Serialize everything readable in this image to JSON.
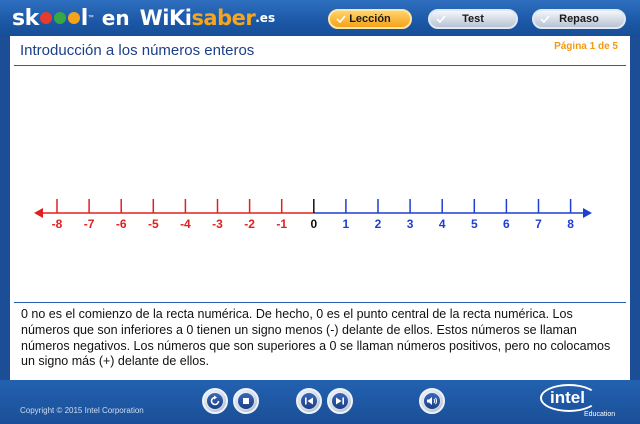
{
  "header": {
    "logo": {
      "skoool": "sk",
      "skoool_tail": "l",
      "tm": "™",
      "en": "en",
      "wikisaber": "WiKi",
      "saber": "saber",
      "es": ".es"
    },
    "tabs": [
      {
        "label": "Lección",
        "active": true
      },
      {
        "label": "Test",
        "active": false
      },
      {
        "label": "Repaso",
        "active": false
      }
    ]
  },
  "content": {
    "title": "Introducción a los números enteros",
    "page_indicator": "Página 1 de 5",
    "number_line": {
      "negative_labels": [
        "-8",
        "-7",
        "-6",
        "-5",
        "-4",
        "-3",
        "-2",
        "-1"
      ],
      "zero_label": "0",
      "positive_labels": [
        "1",
        "2",
        "3",
        "4",
        "5",
        "6",
        "7",
        "8"
      ],
      "colors": {
        "negative": "#e0201e",
        "zero": "#111111",
        "positive": "#1f3fd0"
      }
    },
    "explanation": "0 no es el comienzo de la recta numérica. De hecho, 0 es el punto central de la recta numérica. Los números que son inferiores a 0 tienen un signo menos (-) delante de ellos. Estos números se llaman números negativos. Los números que son superiores a 0 se llaman números positivos, pero no colocamos un signo más (+) delante de ellos."
  },
  "footer": {
    "copyright": "Copyright © 2015 Intel Corporation",
    "controls": [
      "replay-icon",
      "stop-icon",
      "previous-icon",
      "next-icon",
      "audio-icon"
    ],
    "brand": {
      "name": "intel",
      "sub": "Education"
    }
  },
  "colors": {
    "accent": "#1b4e96",
    "page_indicator": "#f29a12",
    "title": "#1c3f8a"
  }
}
